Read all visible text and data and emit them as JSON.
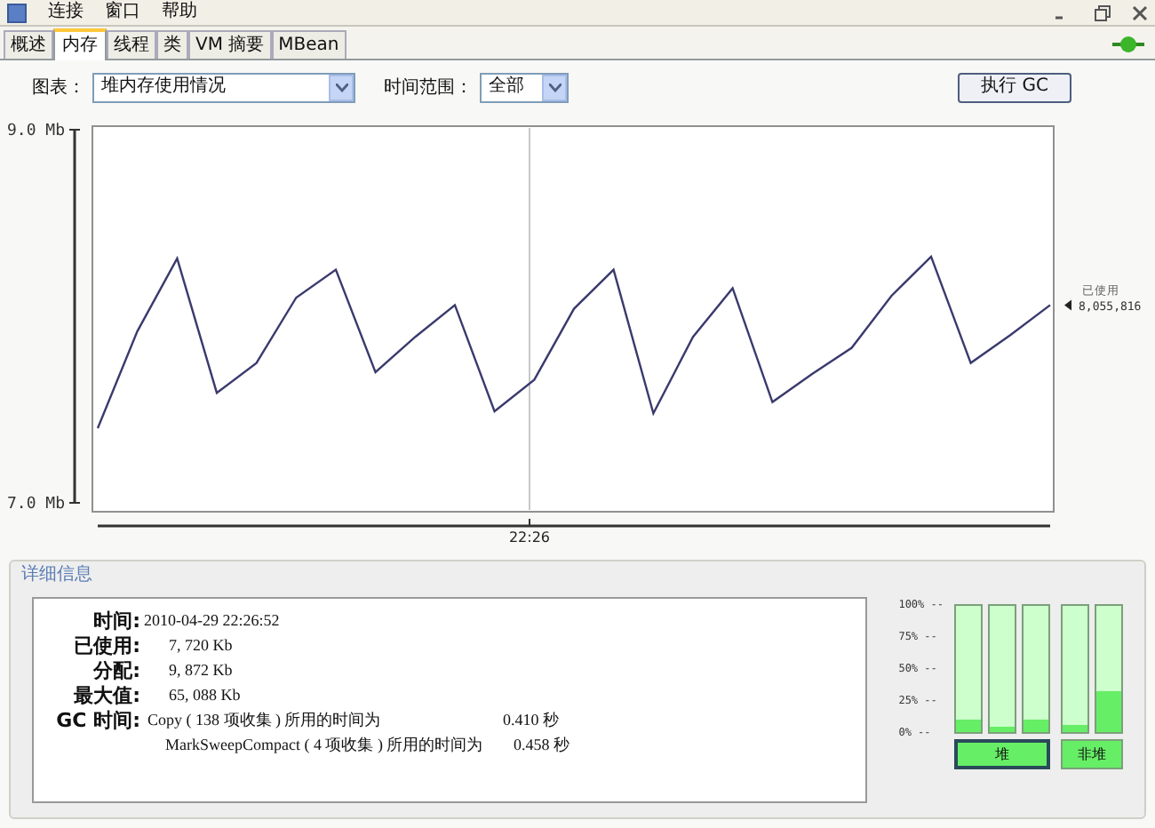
{
  "menu": [
    "连接",
    "窗口",
    "帮助"
  ],
  "tabs": [
    {
      "label": "概述",
      "selected": false
    },
    {
      "label": "内存",
      "selected": true
    },
    {
      "label": "线程",
      "selected": false
    },
    {
      "label": "类",
      "selected": false
    },
    {
      "label": "VM 摘要",
      "selected": false
    },
    {
      "label": "MBean",
      "selected": false
    }
  ],
  "controls": {
    "chart_label": "图表：",
    "chart_value": "堆内存使用情况",
    "range_label": "时间范围：",
    "range_value": "全部",
    "gc_button": "执行 GC"
  },
  "chart": {
    "side_value": "8,055,816",
    "time_label": "22:26",
    "chart_data": {
      "type": "line",
      "series": [
        {
          "name": "已使用",
          "color": "#3a3a6e",
          "values": [
            7.4,
            7.92,
            8.31,
            7.59,
            7.75,
            8.1,
            8.25,
            7.7,
            7.89,
            8.06,
            7.49,
            7.66,
            8.04,
            8.25,
            7.48,
            7.89,
            8.15,
            7.54,
            7.69,
            7.83,
            8.11,
            8.32,
            7.75,
            7.9,
            8.06
          ]
        }
      ],
      "ylim": [
        7.0,
        9.0
      ],
      "yticks": [
        {
          "value": 9.0,
          "label": "9.0 Mb"
        },
        {
          "value": 7.0,
          "label": "7.0 Mb"
        }
      ]
    }
  },
  "details": {
    "title": "详细信息",
    "rows": [
      {
        "label": "时间:",
        "value": "2010-04-29 22:26:52"
      },
      {
        "label": "已使用:",
        "value": "7, 720 Kb"
      },
      {
        "label": "分配:",
        "value": "9, 872 Kb"
      },
      {
        "label": "最大值:",
        "value": "65, 088 Kb"
      }
    ],
    "gc": {
      "label": "GC 时间:",
      "lines": [
        {
          "collector": "Copy ( 138 项收集 ) 所用的时间为",
          "time": "0.410 秒"
        },
        {
          "collector": "MarkSweepCompact ( 4 项收集 ) 所用的时间为",
          "time": "0.458 秒"
        }
      ]
    }
  },
  "pools": {
    "scale": [
      "100% --",
      "75% --",
      "50% --",
      "25% --",
      "0% --"
    ],
    "groups": [
      {
        "label": "堆",
        "selected": true,
        "bars": [
          {
            "level": 0.1
          },
          {
            "level": 0.04
          },
          {
            "level": 0.1
          }
        ]
      },
      {
        "label": "非堆",
        "selected": false,
        "bars": [
          {
            "level": 0.05
          },
          {
            "level": 0.33
          }
        ]
      }
    ]
  }
}
